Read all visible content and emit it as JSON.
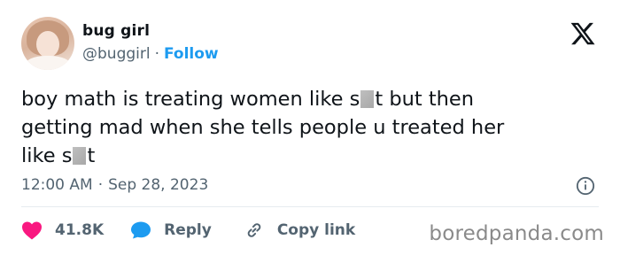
{
  "author": {
    "name": "bug girl",
    "handle": "@buggirl",
    "separator": "·",
    "follow_label": "Follow"
  },
  "tweet": {
    "line1_a": "boy math is treating women like s",
    "line1_b": "t but then",
    "line2": "getting mad when she tells people u treated her",
    "line3_a": "like s",
    "line3_b": "t"
  },
  "meta": {
    "time": "12:00 AM",
    "separator": "·",
    "date": "Sep 28, 2023"
  },
  "actions": {
    "likes_count": "41.8K",
    "reply_label": "Reply",
    "copy_link_label": "Copy link"
  },
  "watermark": "boredpanda.com",
  "colors": {
    "accent": "#1d9bf0",
    "like": "#f91880",
    "text": "#0f1419",
    "muted": "#536471"
  },
  "icons": [
    "x-logo-icon",
    "info-icon",
    "heart-icon",
    "reply-bubble-icon",
    "link-icon"
  ]
}
